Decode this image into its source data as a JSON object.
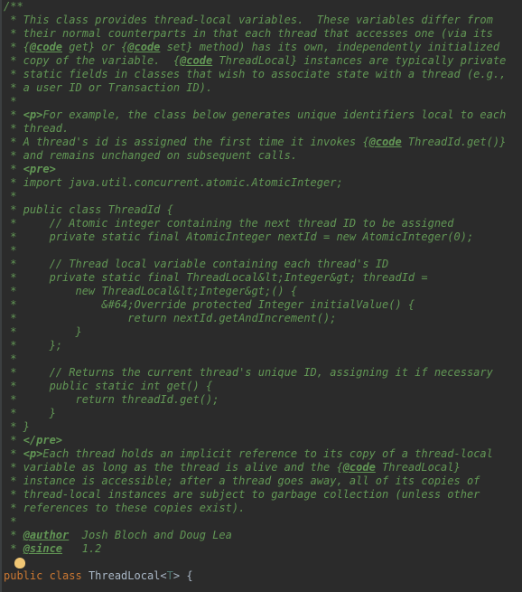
{
  "doc": {
    "l0": "/**",
    "l1": " * This class provides thread-local variables.  These variables differ from",
    "l2": " * their normal counterparts in that each thread that accesses one (via its",
    "l3a": " * {",
    "l3b": " get} or {",
    "l3c": " set} method) has its own, independently initialized",
    "l4a": " * copy of the variable.  {",
    "l4b": " ThreadLocal} instances are typically private",
    "l5": " * static fields in classes that wish to associate state with a thread (e.g.,",
    "l6": " * a user ID or Transaction ID).",
    "l7": " *",
    "l8a": " * ",
    "l8b": "For example, the class below generates unique identifiers local to each",
    "l9": " * thread.",
    "l10a": " * A thread's id is assigned the first time it invokes {",
    "l10b": " ThreadId.get()}",
    "l11": " * and remains unchanged on subsequent calls.",
    "l12a": " * ",
    "l13": " * import java.util.concurrent.atomic.AtomicInteger;",
    "l14": " *",
    "l15": " * public class ThreadId {",
    "l16": " *     // Atomic integer containing the next thread ID to be assigned",
    "l17": " *     private static final AtomicInteger nextId = new AtomicInteger(0);",
    "l18": " *",
    "l19": " *     // Thread local variable containing each thread's ID",
    "l20": " *     private static final ThreadLocal&lt;Integer&gt; threadId =",
    "l21": " *         new ThreadLocal&lt;Integer&gt;() {",
    "l22": " *             &#64;Override protected Integer initialValue() {",
    "l23": " *                 return nextId.getAndIncrement();",
    "l24": " *         }",
    "l25": " *     };",
    "l26": " *",
    "l27": " *     // Returns the current thread's unique ID, assigning it if necessary",
    "l28": " *     public static int get() {",
    "l29": " *         return threadId.get();",
    "l30": " *     }",
    "l31": " * }",
    "l32a": " * ",
    "l33a": " * ",
    "l33b": "Each thread holds an implicit reference to its copy of a thread-local",
    "l34a": " * variable as long as the thread is alive and the {",
    "l34b": " ThreadLocal}",
    "l35": " * instance is accessible; after a thread goes away, all of its copies of",
    "l36": " * thread-local instances are subject to garbage collection (unless other",
    "l37": " * references to these copies exist).",
    "l38": " *",
    "l39a": " * ",
    "l39b": "  Josh Bloch and Doug Lea",
    "l40a": " * ",
    "l40b": "   1.2",
    "tag_code": "@code",
    "tag_p": "<p>",
    "tag_pre": "<pre>",
    "tag_pre_close": "</pre>",
    "tag_author": "@author",
    "tag_since": "@since"
  },
  "code": {
    "kw_public": "public ",
    "kw_class": "class ",
    "cls_name": "ThreadLocal",
    "gen_open": "<",
    "gen_t": "T",
    "gen_close": "> ",
    "brace": "{"
  }
}
